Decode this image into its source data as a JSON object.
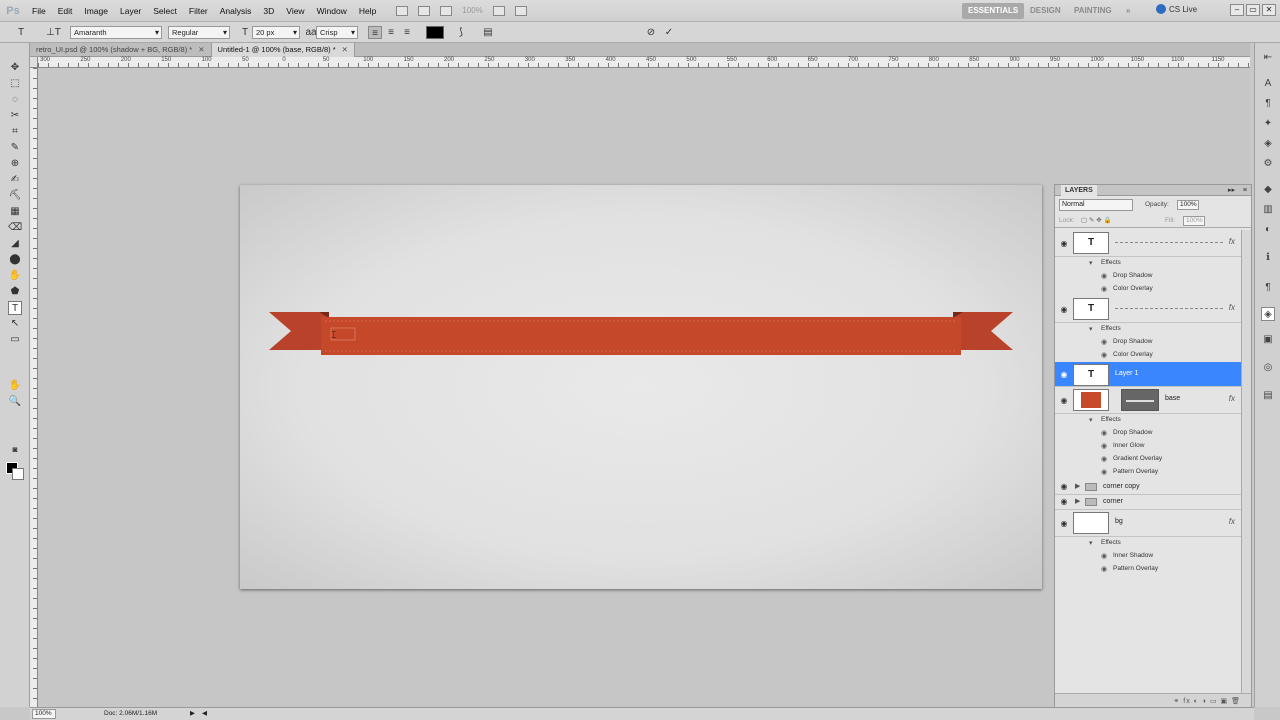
{
  "app": {
    "logo": "Ps"
  },
  "menu": [
    "File",
    "Edit",
    "Image",
    "Layer",
    "Select",
    "Filter",
    "Analysis",
    "3D",
    "View",
    "Window",
    "Help"
  ],
  "menu_zoom": "100%",
  "workspaces": {
    "essentials": "ESSENTIALS",
    "design": "DESIGN",
    "painting": "PAINTING",
    "more": "»"
  },
  "cs_live": "CS Live",
  "window_buttons": {
    "minimize": "–",
    "restore": "▭",
    "close": "✕"
  },
  "options": {
    "tool_glyph": "T",
    "orient_glyph": "⊥T",
    "font_family": "Amaranth",
    "font_style": "Regular",
    "size_glyph": "T",
    "font_size": "20 px",
    "aa_glyph": "aa",
    "antialias": "Crisp",
    "align_left": "≡",
    "align_center": "≡",
    "align_right": "≡",
    "text_color": "#000000",
    "warp": "⟆",
    "panels": "▤",
    "cancel": "⊘",
    "commit": "✓"
  },
  "tabs": [
    {
      "label": "retro_UI.psd @ 100% (shadow + BG, RGB/8) *",
      "close": "✕"
    },
    {
      "label": "Untitled-1 @ 100% (base, RGB/8) *",
      "close": "✕"
    }
  ],
  "rulers": {
    "h": [
      "300",
      "250",
      "200",
      "150",
      "100",
      "50",
      "0",
      "50",
      "100",
      "150",
      "200",
      "250",
      "300",
      "350",
      "400",
      "450",
      "500",
      "550",
      "600",
      "650",
      "700",
      "750",
      "800",
      "850",
      "900",
      "950",
      "1000",
      "1050",
      "1100",
      "1150"
    ]
  },
  "canvas": {
    "ribbon_color": "#c5482a",
    "ribbon_dark": "#8d2f1a",
    "cursor": "⌶"
  },
  "layers_panel": {
    "title": "LAYERS",
    "header_glyphs": {
      "collapse": "▸▸",
      "menu": "≡"
    },
    "blend_mode": "Normal",
    "opacity_label": "Opacity:",
    "opacity": "100%",
    "lock_label": "Lock:",
    "lock_icons": "▢ ✎ ✥ 🔒",
    "fill_label": "Fill:",
    "fill": "100%",
    "eye": "◉",
    "fx_badge": "fx",
    "fx_glyph": "◉",
    "effects_label": "Effects",
    "fx_effects_icon": "▾",
    "t_glyph": "T",
    "rows": [
      {
        "type": "layer",
        "name": "",
        "thumb": "T",
        "fx": true,
        "effects": [
          "Drop Shadow",
          "Color Overlay"
        ]
      },
      {
        "type": "layer",
        "name": "",
        "thumb": "T",
        "fx": true,
        "effects": [
          "Drop Shadow",
          "Color Overlay"
        ]
      },
      {
        "type": "layer",
        "name": "Layer 1",
        "thumb": "T",
        "selected": true,
        "effects": []
      },
      {
        "type": "layer",
        "name": "base",
        "thumb": "fill",
        "mask": true,
        "fx": true,
        "effects": [
          "Drop Shadow",
          "Inner Glow",
          "Gradient Overlay",
          "Pattern Overlay"
        ]
      },
      {
        "type": "group",
        "name": "corner copy"
      },
      {
        "type": "group",
        "name": "corner"
      },
      {
        "type": "layer",
        "name": "bg",
        "thumb": "blank",
        "fx": true,
        "effects": [
          "Inner Shadow",
          "Pattern Overlay"
        ]
      }
    ],
    "footer_icons": "⚭  fx  ◐  ◑  ▭  ▣  🗑"
  },
  "status": {
    "zoom": "100%",
    "doc": "Doc: 2.06M/1.16M",
    "nav": "▶",
    "left": "◀"
  },
  "tools": [
    "✥",
    "⬚",
    "◌",
    "✂",
    "⌗",
    "✎",
    "⊕",
    "✍",
    "⛏",
    "▦",
    "⌫",
    "◢",
    "⬤",
    "✋",
    "⬟",
    "T",
    "↖",
    "▭",
    "✋",
    "🔍"
  ],
  "dock_icons": [
    "A",
    "¶",
    "✦",
    "◈",
    "⚙",
    "◆",
    "▥",
    "◐",
    "ℹ",
    "¶",
    "◈",
    "▣",
    "◎",
    "▤"
  ]
}
